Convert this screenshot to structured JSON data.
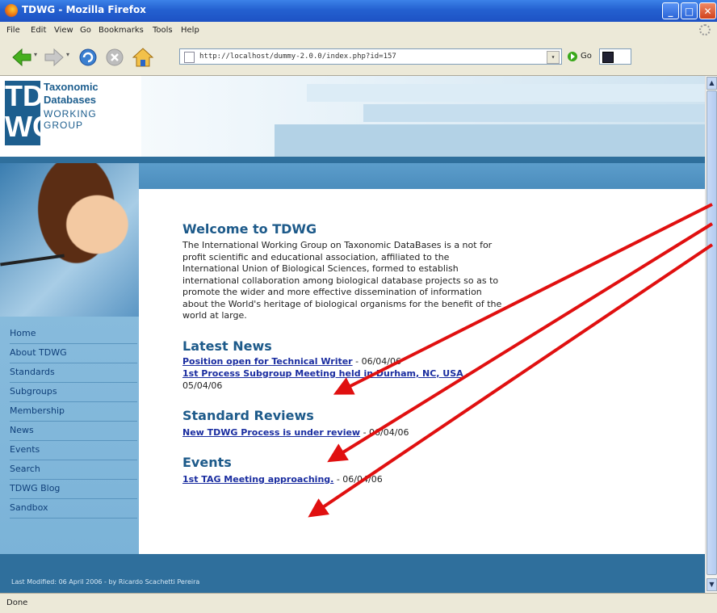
{
  "window": {
    "title": "TDWG - Mozilla Firefox"
  },
  "menu": {
    "items": [
      "File",
      "Edit",
      "View",
      "Go",
      "Bookmarks",
      "Tools",
      "Help"
    ]
  },
  "toolbar": {
    "address": "http://localhost/dummy-2.0.0/index.php?id=157",
    "go_label": "Go"
  },
  "logo": {
    "initials_top": "TD",
    "initials_bottom": "WG",
    "line1": "Taxonomic",
    "line2": "Databases",
    "line3": "WORKING",
    "line4": "GROUP"
  },
  "nav": {
    "items": [
      "Home",
      "About TDWG",
      "Standards",
      "Subgroups",
      "Membership",
      "News",
      "Events",
      "Search",
      "TDWG Blog",
      "Sandbox"
    ]
  },
  "content": {
    "welcome_title": "Welcome to TDWG",
    "welcome_text": "The International Working Group on Taxonomic DataBases is a not for profit scientific and educational association, affiliated to the International Union of Biological Sciences, formed to establish international collaboration among biological database projects so as to promote the wider and more effective dissemination of information about the World's heritage of biological organisms for the benefit of the world at large.",
    "news_title": "Latest News",
    "news": [
      {
        "title": "Position open for Technical Writer",
        "date": " - 06/04/06"
      },
      {
        "title": "1st Process Subgroup Meeting held in Durham, NC, USA",
        "date": " - 05/04/06"
      }
    ],
    "reviews_title": "Standard Reviews",
    "reviews": [
      {
        "title": "New TDWG Process is under review",
        "date": " - 06/04/06"
      }
    ],
    "events_title": "Events",
    "events": [
      {
        "title": "1st TAG Meeting approaching.",
        "date": " - 06/04/06"
      }
    ]
  },
  "footer": {
    "text": "Last Modified: 06 April 2006 - by Ricardo Scachetti Pereira"
  },
  "status": {
    "text": "Done"
  },
  "colors": {
    "accent": "#2f6f9c",
    "link": "#1a2da0",
    "arrow": "#e01010"
  }
}
